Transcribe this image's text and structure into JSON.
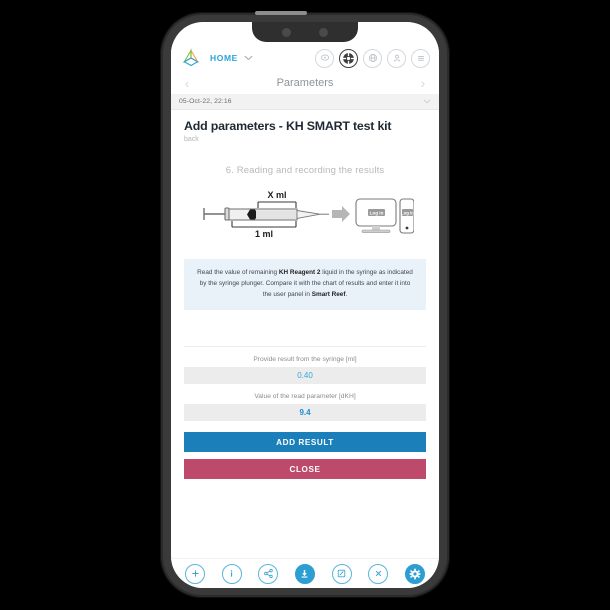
{
  "app": {
    "logo_name": "smart-reef-cube-logo",
    "home_label": "HOME",
    "dropdown_caret": "⌄"
  },
  "header_icons": [
    {
      "name": "message-icon",
      "glyph": "☰"
    },
    {
      "name": "navigation-compass-icon",
      "glyph": "❁"
    },
    {
      "name": "globe-icon",
      "glyph": "◌"
    },
    {
      "name": "user-account-icon",
      "glyph": "○"
    },
    {
      "name": "hamburger-menu-icon",
      "glyph": "≡"
    }
  ],
  "nav": {
    "prev_arrow": "‹",
    "title": "Parameters",
    "next_arrow": "›"
  },
  "date_bar": {
    "timestamp": "05-Oct-22, 22:16",
    "caret": "⌄"
  },
  "page": {
    "title": "Add parameters - KH SMART test kit",
    "back_label": "back",
    "step_title": "6. Reading and recording the results"
  },
  "diagram": {
    "label_top": "X ml",
    "label_bottom": "1 ml",
    "login_label": "Log in"
  },
  "info": {
    "part1": "Read the value of remaining ",
    "bold1": "KH Reagent 2",
    "part2": " liquid in the syringe as indicated by the syringe plunger. Compare it with the chart of results and enter it into the user panel in ",
    "bold2": "Smart Reef",
    "part3": "."
  },
  "form": {
    "fields": [
      {
        "label": "Provide result from the syringe  [ml]",
        "value": "0.40",
        "unit": "ml"
      },
      {
        "label": "Value of the read parameter  [dKH]",
        "value": "9.4",
        "unit": "dKH"
      }
    ]
  },
  "buttons": {
    "add_result": "ADD RESULT",
    "close": "CLOSE"
  },
  "bottom_icons": [
    {
      "name": "add-plus-icon",
      "glyph": "+",
      "filled": false
    },
    {
      "name": "info-icon",
      "glyph": "i",
      "filled": false
    },
    {
      "name": "share-icon",
      "glyph": "",
      "filled": false
    },
    {
      "name": "download-icon",
      "glyph": "",
      "filled": true
    },
    {
      "name": "edit-pencil-icon",
      "glyph": "",
      "filled": false
    },
    {
      "name": "close-x-icon",
      "glyph": "×",
      "filled": false
    },
    {
      "name": "settings-gear-icon",
      "glyph": "",
      "filled": true
    }
  ],
  "colors": {
    "accent_blue": "#1b7fba",
    "brand_light_blue": "#29a3dc",
    "danger_crimson": "#bd4a6b",
    "info_box_bg": "#e9f2f9",
    "input_bg": "#ececec"
  }
}
